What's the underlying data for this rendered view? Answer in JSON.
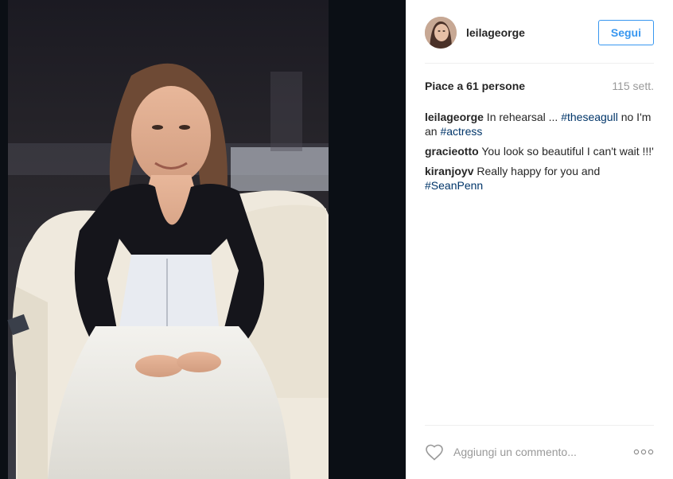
{
  "post": {
    "image_alt_icon": "photo",
    "author": "leilageorge",
    "follow_label": "Segui",
    "likes": "Piace a 61 persone",
    "time_ago": "115 sett.",
    "comments": [
      {
        "user": "leilageorge",
        "parts": [
          " In rehearsal ... ",
          "#theseagull",
          " no I'm an ",
          "#actress"
        ]
      },
      {
        "user": "gracieotto",
        "text": " You look so beautiful I can't wait !!!'"
      },
      {
        "user": "kiranjoyv",
        "parts": [
          " Really happy for you and ",
          "#SeanPenn"
        ]
      }
    ],
    "add_comment_placeholder": "Aggiungi un commento...",
    "more_label": "ooo"
  },
  "colors": {
    "accent": "#3897f0",
    "hashtag": "#003569",
    "muted": "#999999"
  },
  "icons": {
    "like": "heart-icon",
    "options": "more-options-icon"
  }
}
